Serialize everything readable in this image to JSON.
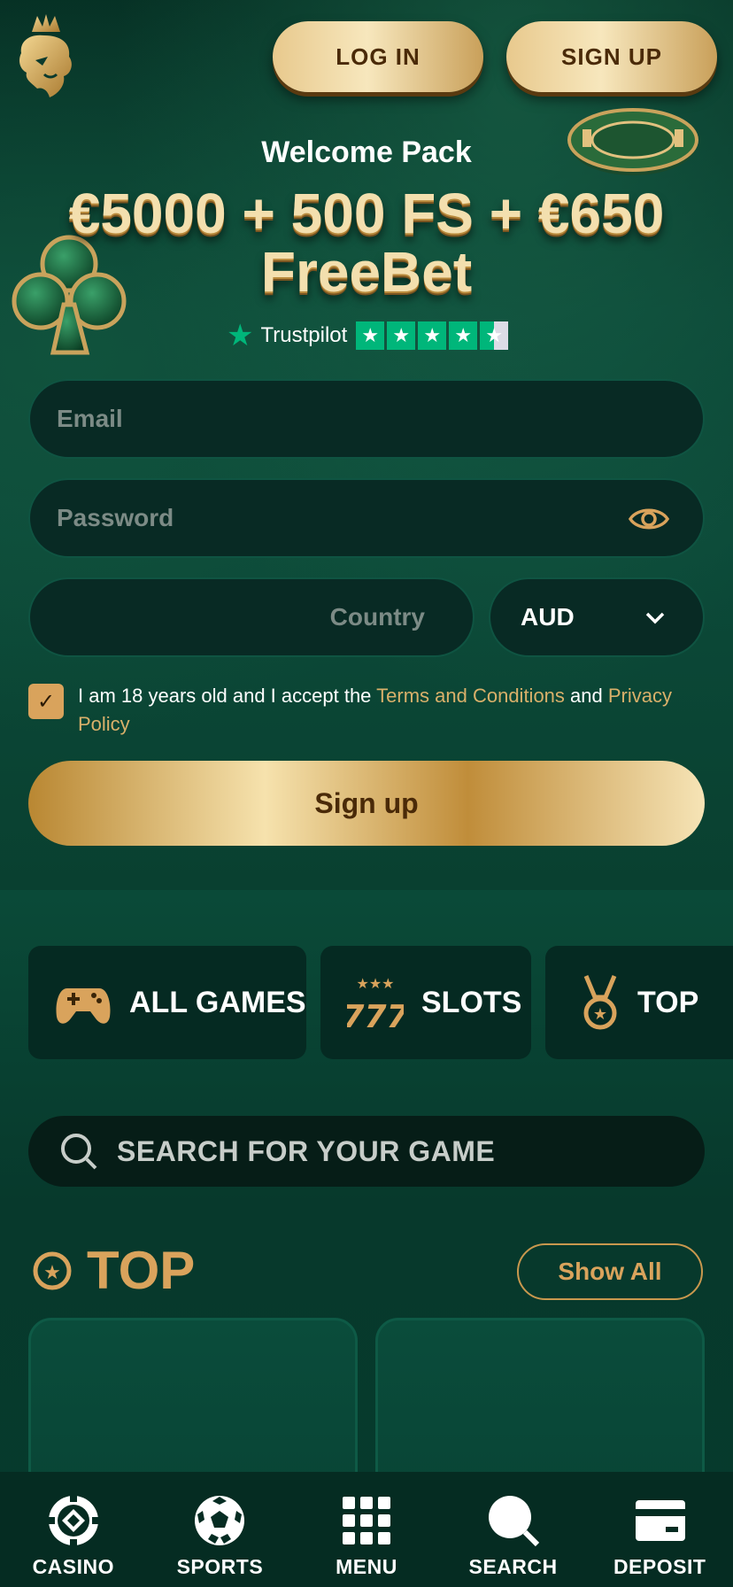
{
  "header": {
    "login_label": "LOG IN",
    "signup_label": "SIGN UP"
  },
  "promo": {
    "welcome": "Welcome Pack",
    "bonus": "€5000 + 500 FS + €650 FreeBet",
    "trust_label": "Trustpilot",
    "trust_stars": 4.5
  },
  "form": {
    "email_placeholder": "Email",
    "password_placeholder": "Password",
    "country_placeholder": "Country",
    "currency": "AUD",
    "agree_prefix": "I am 18 years old and I accept the ",
    "terms_link": "Terms and Conditions",
    "agree_and": " and ",
    "privacy_link": "Privacy Policy",
    "checkbox_checked": true,
    "signup_label": "Sign up"
  },
  "categories": [
    {
      "label": "ALL GAMES",
      "icon": "gamepad-icon"
    },
    {
      "label": "SLOTS",
      "icon": "777-icon"
    },
    {
      "label": "TOP",
      "icon": "medal-icon"
    }
  ],
  "search": {
    "placeholder": "SEARCH FOR YOUR GAME"
  },
  "top_section": {
    "title": "TOP",
    "show_all": "Show All"
  },
  "bottom_nav": [
    {
      "label": "CASINO",
      "icon": "casino-chip-icon"
    },
    {
      "label": "SPORTS",
      "icon": "soccer-ball-icon"
    },
    {
      "label": "MENU",
      "icon": "grid-menu-icon"
    },
    {
      "label": "SEARCH",
      "icon": "search-icon"
    },
    {
      "label": "DEPOSIT",
      "icon": "card-icon"
    }
  ],
  "colors": {
    "gold": "#d9a35c",
    "background": "#07352a",
    "trust_green": "#00b67a"
  }
}
